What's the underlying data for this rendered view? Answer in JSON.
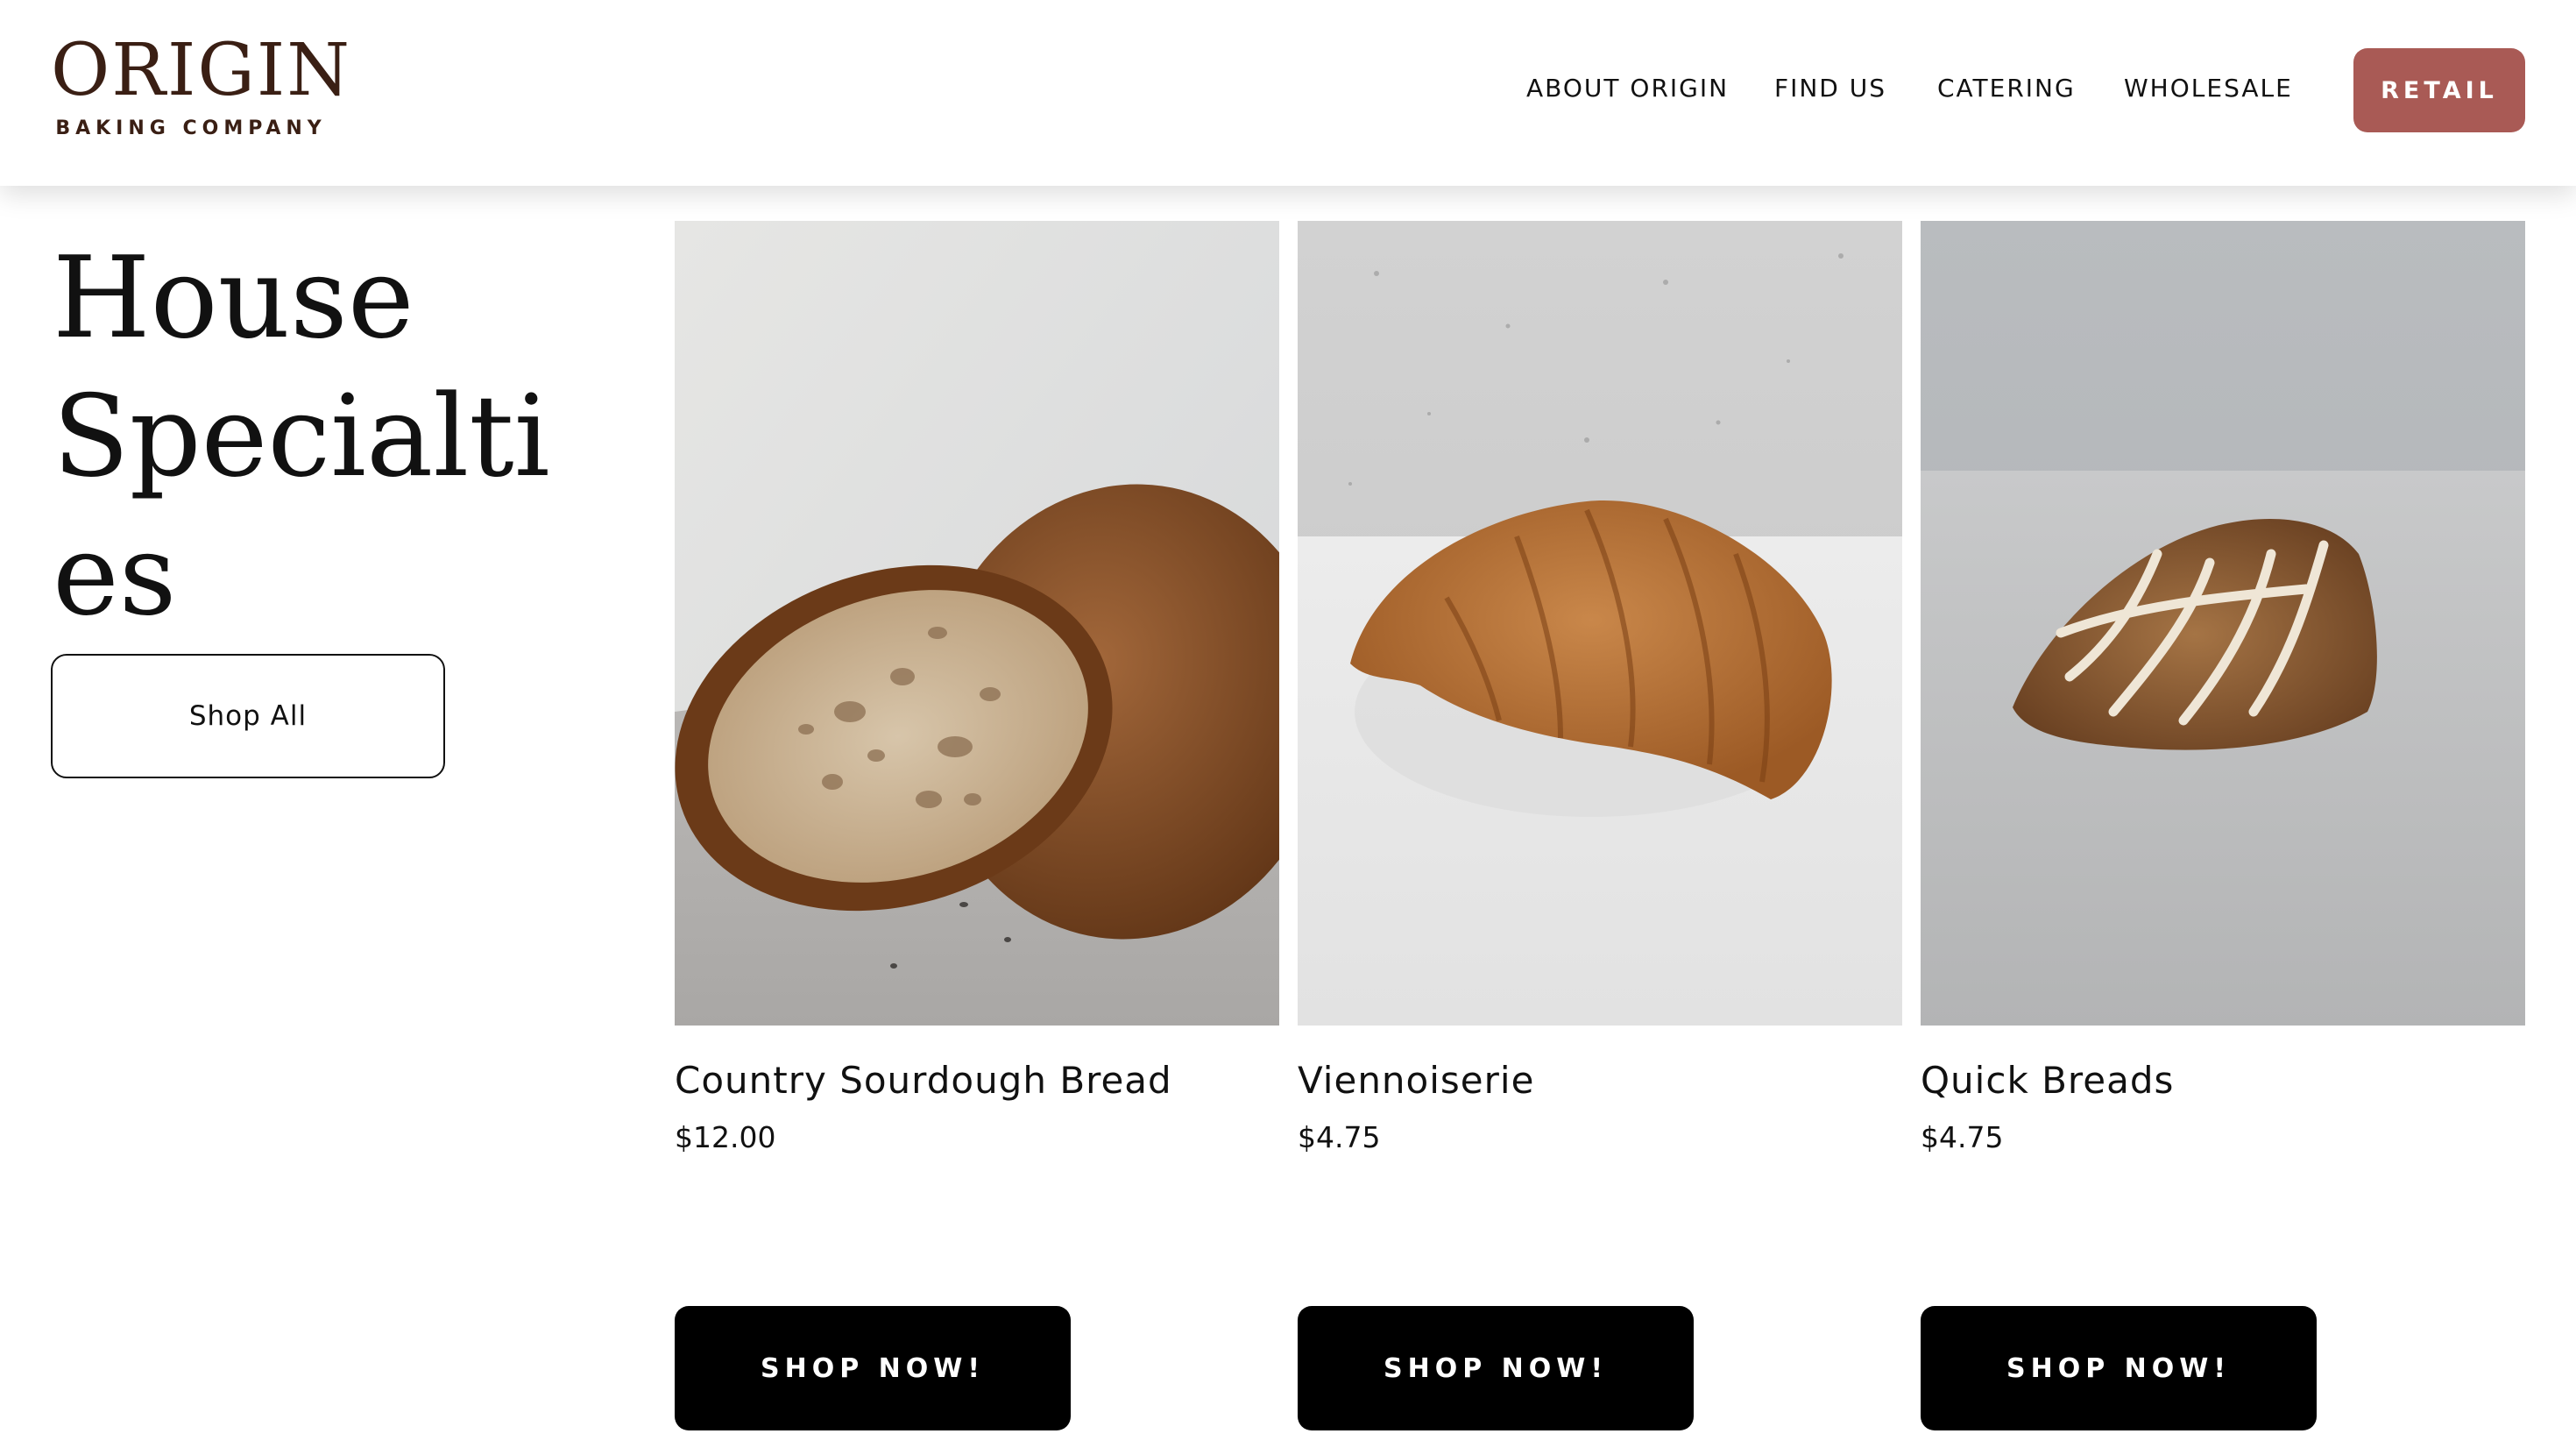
{
  "brand": {
    "name": "ORIGIN",
    "tagline": "BAKING COMPANY",
    "color": "#3a1f14"
  },
  "nav": {
    "items": [
      {
        "label": "ABOUT ORIGIN"
      },
      {
        "label": "FIND US"
      },
      {
        "label": "CATERING"
      },
      {
        "label": "WHOLESALE"
      }
    ],
    "retail_label": "RETAIL",
    "retail_color": "#a95a55"
  },
  "section": {
    "heading_line1": "House",
    "heading_line2": "Specialties",
    "shop_all_label": "Shop All"
  },
  "products": [
    {
      "title": "Country Sourdough Bread",
      "price": "$12.00",
      "cta": "SHOP NOW!",
      "image_icon": "sourdough-bread-image"
    },
    {
      "title": "Viennoiserie",
      "price": "$4.75",
      "cta": "SHOP NOW!",
      "image_icon": "croissant-image"
    },
    {
      "title": "Quick Breads",
      "price": "$4.75",
      "cta": "SHOP NOW!",
      "image_icon": "scone-image"
    }
  ]
}
